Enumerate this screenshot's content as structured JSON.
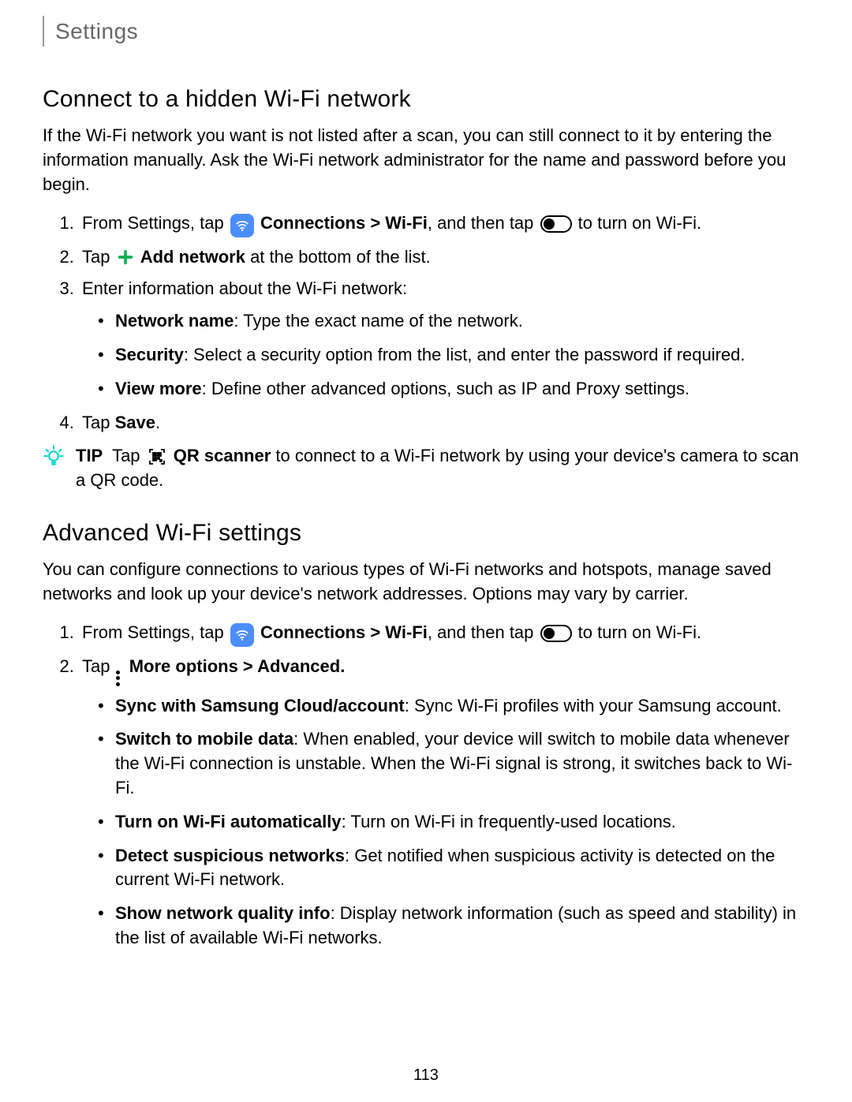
{
  "header": "Settings",
  "section1": {
    "title": "Connect to a hidden Wi-Fi network",
    "intro": "If the Wi-Fi network you want is not listed after a scan, you can still connect to it by entering the information manually. Ask the Wi-Fi network administrator for the name and password before you begin.",
    "step1_a": "From Settings, tap ",
    "step1_b": "Connections > Wi-Fi",
    "step1_c": ", and then tap ",
    "step1_d": " to turn on Wi-Fi.",
    "step2_a": "Tap ",
    "step2_b": "Add network",
    "step2_c": " at the bottom of the list.",
    "step3": "Enter information about the Wi-Fi network:",
    "bullet1_a": "Network name",
    "bullet1_b": ": Type the exact name of the network.",
    "bullet2_a": "Security",
    "bullet2_b": ": Select a security option from the list, and enter the password if required.",
    "bullet3_a": "View more",
    "bullet3_b": ": Define other advanced options, such as IP and Proxy settings.",
    "step4_a": "Tap ",
    "step4_b": "Save",
    "step4_c": ".",
    "tip_label": "TIP",
    "tip_a": "Tap ",
    "tip_b": "QR scanner",
    "tip_c": " to connect to a Wi-Fi network by using your device's camera to scan a QR code."
  },
  "section2": {
    "title": "Advanced Wi-Fi settings",
    "intro": "You can configure connections to various types of Wi-Fi networks and hotspots, manage saved networks and look up your device's network addresses. Options may vary by carrier.",
    "step1_a": "From Settings, tap ",
    "step1_b": "Connections > Wi-Fi",
    "step1_c": ", and then tap ",
    "step1_d": " to turn on Wi-Fi.",
    "step2_a": "Tap ",
    "step2_b": "More options > Advanced.",
    "b1_a": "Sync with Samsung Cloud/account",
    "b1_b": ": Sync Wi-Fi profiles with your Samsung account.",
    "b2_a": "Switch to mobile data",
    "b2_b": ": When enabled, your device will switch to mobile data whenever the Wi-Fi connection is unstable. When the Wi-Fi signal is strong, it switches back to Wi-Fi.",
    "b3_a": "Turn on Wi-Fi automatically",
    "b3_b": ": Turn on Wi-Fi in frequently-used locations.",
    "b4_a": "Detect suspicious networks",
    "b4_b": ": Get notified when suspicious activity is detected on the current Wi-Fi network.",
    "b5_a": "Show network quality info",
    "b5_b": ": Display network information (such as speed and stability) in the list of available Wi-Fi networks."
  },
  "page_number": "113"
}
